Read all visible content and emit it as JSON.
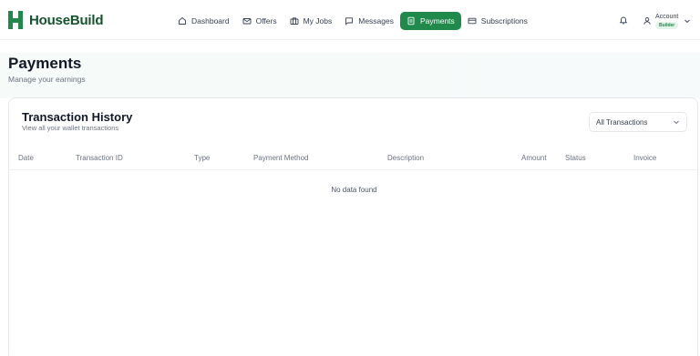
{
  "app": {
    "logo_text": "HouseBuild"
  },
  "nav": {
    "items": [
      {
        "label": "Dashboard",
        "icon": "home-icon"
      },
      {
        "label": "Offers",
        "icon": "mail-icon"
      },
      {
        "label": "My Jobs",
        "icon": "briefcase-icon"
      },
      {
        "label": "Messages",
        "icon": "message-icon"
      },
      {
        "label": "Payments",
        "icon": "receipt-icon",
        "active": true
      },
      {
        "label": "Subscriptions",
        "icon": "card-icon"
      }
    ]
  },
  "account": {
    "label": "Account",
    "role": "Builder"
  },
  "page": {
    "title": "Payments",
    "subtitle": "Manage your earnings"
  },
  "transactions": {
    "title": "Transaction History",
    "subtitle": "View all your wallet transactions",
    "filter_value": "All Transactions",
    "columns": [
      "Date",
      "Transaction ID",
      "Type",
      "Payment Method",
      "Description",
      "Amount",
      "Status",
      "Invoice"
    ],
    "empty_text": "No data found"
  },
  "colors": {
    "accent": "#1f8a4c",
    "brand_text": "#14532d"
  }
}
